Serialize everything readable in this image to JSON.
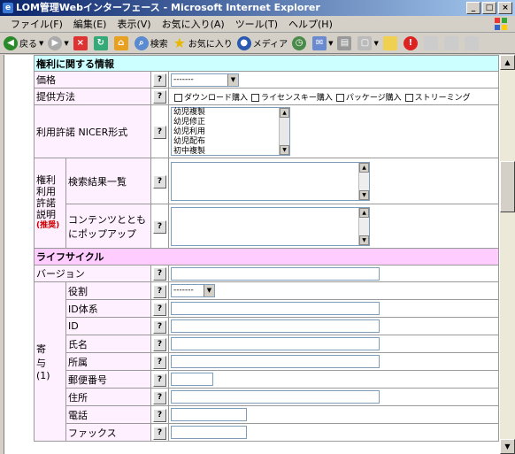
{
  "window": {
    "title": "LOM管理Webインターフェース - Microsoft Internet Explorer"
  },
  "menu": [
    "ファイル(F)",
    "編集(E)",
    "表示(V)",
    "お気に入り(A)",
    "ツール(T)",
    "ヘルプ(H)"
  ],
  "toolbar": {
    "back": "戻る",
    "search": "検索",
    "favorites": "お気に入り",
    "media": "メディア"
  },
  "rights": {
    "header": "権利に関する情報",
    "price_label": "価格",
    "price_value": "-------",
    "method_label": "提供方法",
    "methods": [
      "ダウンロード購入",
      "ライセンスキー購入",
      "パッケージ購入",
      "ストリーミング"
    ],
    "license_label": "利用許諾 NICER形式",
    "license_options": [
      "幼児複製",
      "幼児修正",
      "幼児利用",
      "幼児配布",
      "初中複製"
    ],
    "desc_label": "権利利用許諾説明",
    "desc_recommended": "(推奨)",
    "desc_list_label": "検索結果一覧",
    "desc_popup_label": "コンテンツとともにポップアップ"
  },
  "lifecycle": {
    "header": "ライフサイクル",
    "version_label": "バージョン",
    "contrib_label": "寄与(1)",
    "role_label": "役割",
    "role_value": "-------",
    "fields": [
      "ID体系",
      "ID",
      "氏名",
      "所属",
      "郵便番号",
      "住所",
      "電話",
      "ファックス"
    ]
  },
  "q": "?"
}
